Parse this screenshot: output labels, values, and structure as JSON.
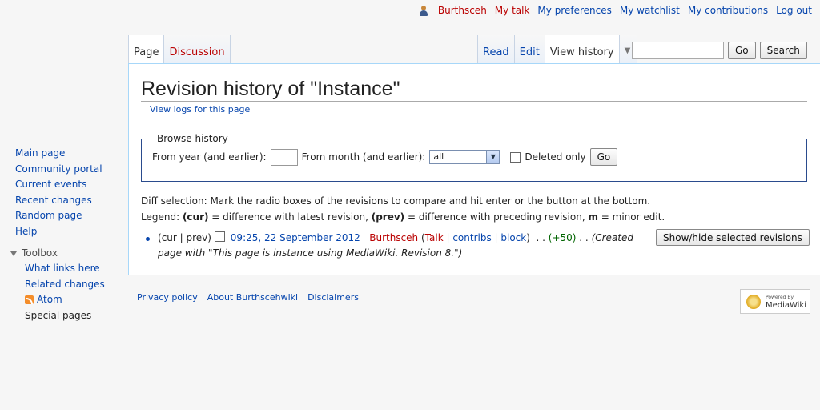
{
  "personal": {
    "user": "Burthsceh",
    "talk": "My talk",
    "preferences": "My preferences",
    "watchlist": "My watchlist",
    "contributions": "My contributions",
    "logout": "Log out"
  },
  "tabs": {
    "page": "Page",
    "discussion": "Discussion",
    "read": "Read",
    "edit": "Edit",
    "view_history": "View history",
    "more_caret": "▼"
  },
  "search": {
    "value": "",
    "go": "Go",
    "search": "Search"
  },
  "main": {
    "title": "Revision history of \"Instance\"",
    "view_logs": "View logs for this page",
    "browse": {
      "legend": "Browse history",
      "year_label": "From year (and earlier):",
      "year_value": "",
      "month_label": "From month (and earlier):",
      "month_value": "all",
      "deleted_only": "Deleted only",
      "go": "Go"
    },
    "diff_selection": "Diff selection: Mark the radio boxes of the revisions to compare and hit enter or the button at the bottom.",
    "legend": {
      "prefix": "Legend: ",
      "cur": "(cur)",
      "cur_desc": " = difference with latest revision, ",
      "prev": "(prev)",
      "prev_desc": " = difference with preceding revision, ",
      "m": "m",
      "m_desc": " = minor edit."
    },
    "revision": {
      "cur": "cur",
      "prev": "prev",
      "timestamp": "09:25, 22 September 2012",
      "user": "Burthsceh",
      "talk": "Talk",
      "contribs": "contribs",
      "block": "block",
      "size": "(+50)",
      "summary": "(Created page with \"This page is instance using MediaWiki. Revision 8.\")"
    },
    "show_hide": "Show/hide selected revisions"
  },
  "sidebar": {
    "nav": [
      "Main page",
      "Community portal",
      "Current events",
      "Recent changes",
      "Random page",
      "Help"
    ],
    "toolbox_title": "Toolbox",
    "toolbox": {
      "what_links_here": "What links here",
      "related_changes": "Related changes",
      "atom": "Atom",
      "special_pages": "Special pages"
    }
  },
  "footer": {
    "privacy": "Privacy policy",
    "about": "About Burthscehwiki",
    "disclaimers": "Disclaimers",
    "powered_small": "Powered By",
    "powered_big": "MediaWiki"
  },
  "colors": {
    "link": "#0645ad",
    "redlink": "#ba0000",
    "border": "#a7d7f9",
    "size_positive": "#006400"
  }
}
